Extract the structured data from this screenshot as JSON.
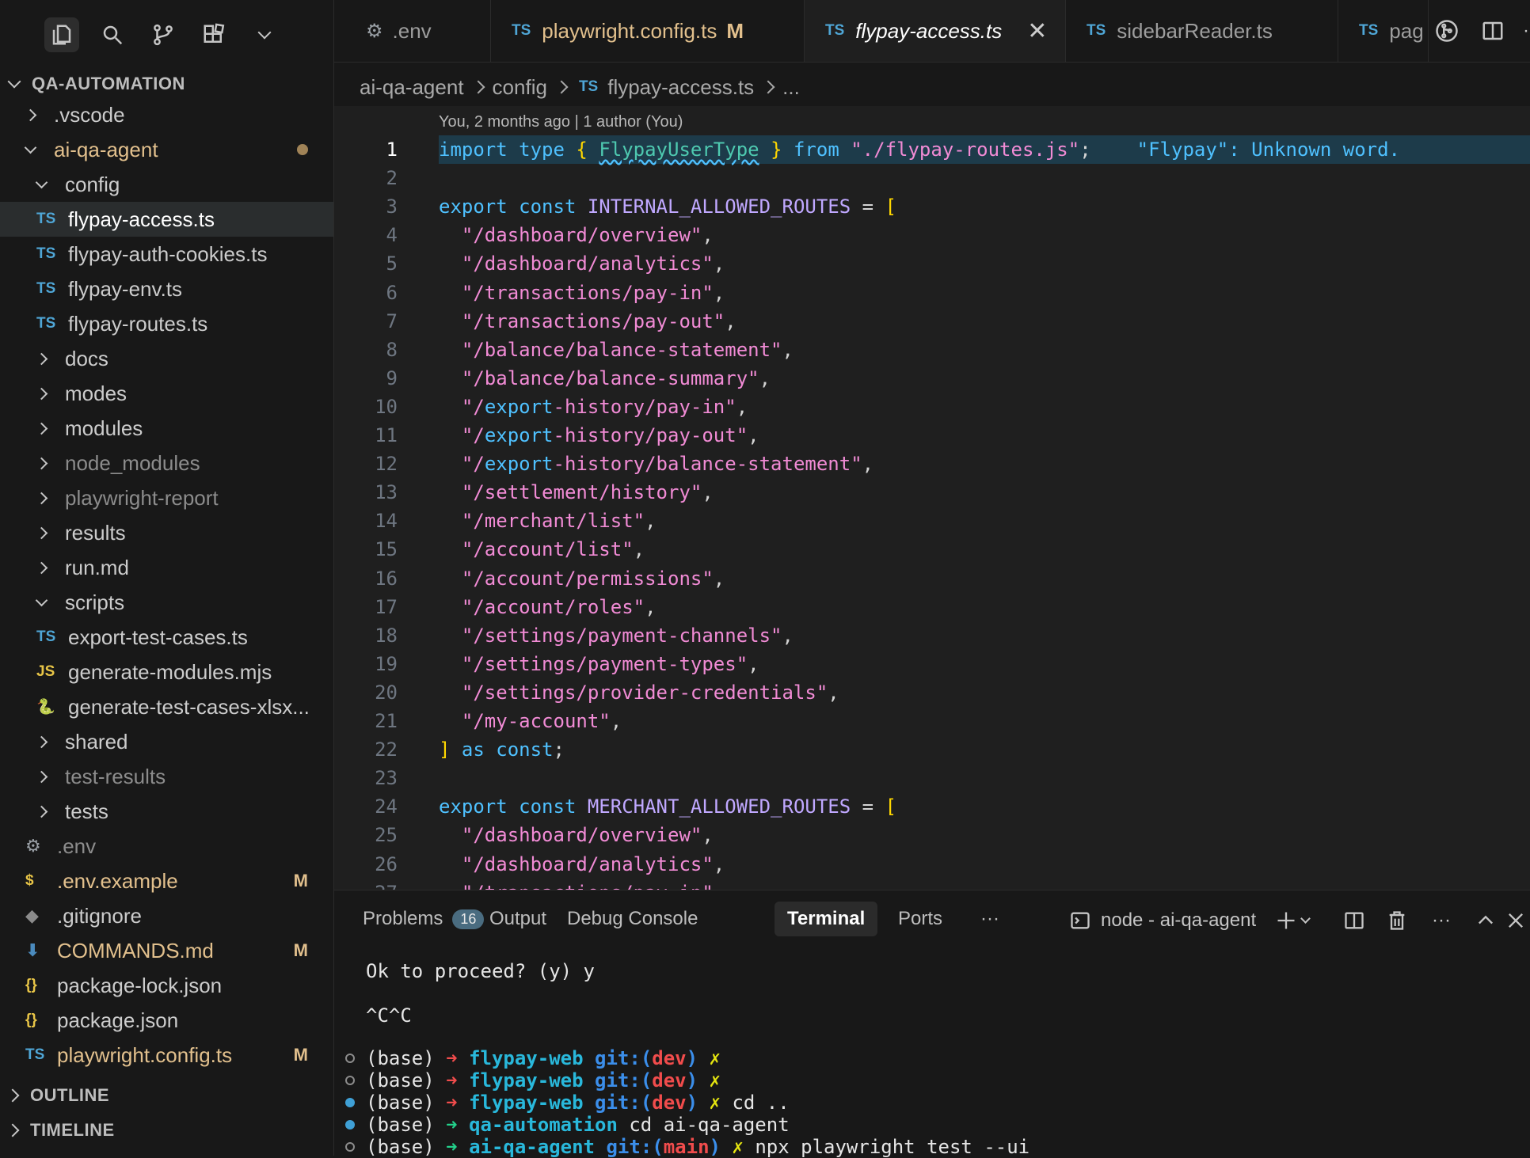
{
  "explorer": {
    "root": "QA-AUTOMATION",
    "outline": "OUTLINE",
    "timeline": "TIMELINE"
  },
  "tree": [
    {
      "label": ".vscode",
      "type": "folder",
      "expanded": false,
      "depth": 1
    },
    {
      "label": "ai-qa-agent",
      "type": "folder",
      "expanded": true,
      "depth": 1,
      "modified": true
    },
    {
      "label": "config",
      "type": "folder",
      "expanded": true,
      "depth": 2
    },
    {
      "label": "flypay-access.ts",
      "type": "ts",
      "depth": 3,
      "selected": true
    },
    {
      "label": "flypay-auth-cookies.ts",
      "type": "ts",
      "depth": 3
    },
    {
      "label": "flypay-env.ts",
      "type": "ts",
      "depth": 3
    },
    {
      "label": "flypay-routes.ts",
      "type": "ts",
      "depth": 3
    },
    {
      "label": "docs",
      "type": "folder",
      "expanded": false,
      "depth": 2
    },
    {
      "label": "modes",
      "type": "folder",
      "expanded": false,
      "depth": 2
    },
    {
      "label": "modules",
      "type": "folder",
      "expanded": false,
      "depth": 2
    },
    {
      "label": "node_modules",
      "type": "folder",
      "expanded": false,
      "depth": 2,
      "dim": true
    },
    {
      "label": "playwright-report",
      "type": "folder",
      "expanded": false,
      "depth": 2,
      "dim": true
    },
    {
      "label": "results",
      "type": "folder",
      "expanded": false,
      "depth": 2
    },
    {
      "label": "run.md",
      "type": "folder",
      "expanded": false,
      "depth": 2
    },
    {
      "label": "scripts",
      "type": "folder",
      "expanded": true,
      "depth": 2
    },
    {
      "label": "export-test-cases.ts",
      "type": "ts",
      "depth": 3
    },
    {
      "label": "generate-modules.mjs",
      "type": "js",
      "depth": 3
    },
    {
      "label": "generate-test-cases-xlsx...",
      "type": "py",
      "depth": 3
    },
    {
      "label": "shared",
      "type": "folder",
      "expanded": false,
      "depth": 2
    },
    {
      "label": "test-results",
      "type": "folder",
      "expanded": false,
      "depth": 2,
      "dim": true
    },
    {
      "label": "tests",
      "type": "folder",
      "expanded": false,
      "depth": 2
    },
    {
      "label": ".env",
      "type": "gear",
      "depth": 2,
      "dim": true
    },
    {
      "label": ".env.example",
      "type": "dollar",
      "depth": 2,
      "badge": "M"
    },
    {
      "label": ".gitignore",
      "type": "git",
      "depth": 2
    },
    {
      "label": "COMMANDS.md",
      "type": "md",
      "depth": 2,
      "badge": "M"
    },
    {
      "label": "package-lock.json",
      "type": "json",
      "depth": 2
    },
    {
      "label": "package.json",
      "type": "json",
      "depth": 2
    },
    {
      "label": "playwright.config.ts",
      "type": "ts",
      "depth": 2,
      "badge": "M"
    }
  ],
  "tabs": [
    {
      "icon": "gear-icon",
      "label": ".env"
    },
    {
      "icon": "TS",
      "label": "playwright.config.ts",
      "mark": "M"
    },
    {
      "icon": "TS",
      "label": "flypay-access.ts",
      "active": true
    },
    {
      "icon": "TS",
      "label": "sidebarReader.ts"
    },
    {
      "icon": "TS",
      "label": "pag"
    }
  ],
  "breadcrumb": {
    "parts": [
      "ai-qa-agent",
      "config"
    ],
    "file_icon": "TS",
    "file": "flypay-access.ts",
    "more": "..."
  },
  "editor": {
    "blame": "You, 2 months ago | 1 author (You)",
    "hint": "\"Flypay\": Unknown word.",
    "lines": [
      "import type { FlypayUserType } from \"./flypay-routes.js\";",
      "",
      "export const INTERNAL_ALLOWED_ROUTES = [",
      "  \"/dashboard/overview\",",
      "  \"/dashboard/analytics\",",
      "  \"/transactions/pay-in\",",
      "  \"/transactions/pay-out\",",
      "  \"/balance/balance-statement\",",
      "  \"/balance/balance-summary\",",
      "  \"/export-history/pay-in\",",
      "  \"/export-history/pay-out\",",
      "  \"/export-history/balance-statement\",",
      "  \"/settlement/history\",",
      "  \"/merchant/list\",",
      "  \"/account/list\",",
      "  \"/account/permissions\",",
      "  \"/account/roles\",",
      "  \"/settings/payment-channels\",",
      "  \"/settings/payment-types\",",
      "  \"/settings/provider-credentials\",",
      "  \"/my-account\",",
      "] as const;",
      "",
      "export const MERCHANT_ALLOWED_ROUTES = [",
      "  \"/dashboard/overview\",",
      "  \"/dashboard/analytics\",",
      "  \"/transactions/pay-in\","
    ]
  },
  "panel": {
    "tabs": {
      "problems": "Problems",
      "problems_count": "16",
      "output": "Output",
      "debug": "Debug Console",
      "terminal": "Terminal",
      "ports": "Ports",
      "more": "···"
    },
    "terminal_name": "node - ai-qa-agent",
    "more_actions": "···"
  },
  "terminal": {
    "prompt_line": "Ok to proceed? (y) y",
    "ctrl_c": "^C^C",
    "entries": [
      {
        "status": "empty",
        "base": "(base)",
        "arrow": "➜",
        "arrow_color": "red",
        "dir": "flypay-web",
        "git": "git:(",
        "branch": "dev",
        "git_close": ")",
        "dirty": "✗",
        "cmd": ""
      },
      {
        "status": "empty",
        "base": "(base)",
        "arrow": "➜",
        "arrow_color": "red",
        "dir": "flypay-web",
        "git": "git:(",
        "branch": "dev",
        "git_close": ")",
        "dirty": "✗",
        "cmd": ""
      },
      {
        "status": "filled",
        "base": "(base)",
        "arrow": "➜",
        "arrow_color": "red",
        "dir": "flypay-web",
        "git": "git:(",
        "branch": "dev",
        "git_close": ")",
        "dirty": "✗",
        "cmd": "cd .."
      },
      {
        "status": "filled",
        "base": "(base)",
        "arrow": "➜",
        "arrow_color": "green",
        "dir": "qa-automation",
        "git": "",
        "branch": "",
        "git_close": "",
        "dirty": "",
        "cmd": "cd ai-qa-agent"
      },
      {
        "status": "empty",
        "base": "(base)",
        "arrow": "➜",
        "arrow_color": "green",
        "dir": "ai-qa-agent",
        "git": "git:(",
        "branch": "main",
        "git_close": ")",
        "dirty": "✗",
        "cmd": "npx playwright test --ui"
      }
    ]
  },
  "colors": {
    "background": "#181818",
    "editor_bg": "#1f1f1f",
    "accent": "#4fa6d6",
    "modified": "#e2c08d"
  }
}
